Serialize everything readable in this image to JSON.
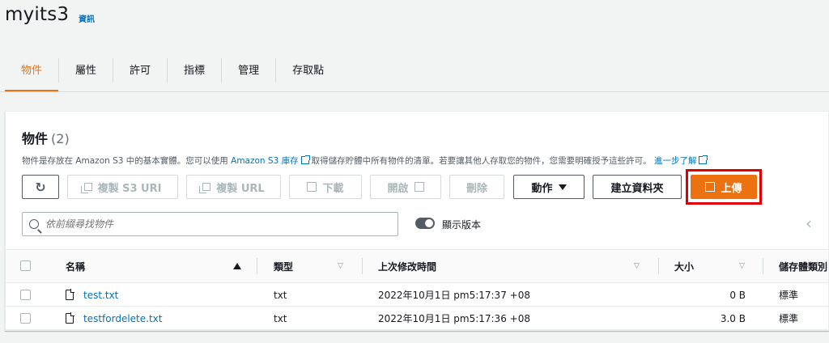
{
  "bucket": {
    "name": "myits3",
    "info_label": "資訊"
  },
  "tabs": [
    {
      "label": "物件",
      "active": true
    },
    {
      "label": "屬性"
    },
    {
      "label": "許可"
    },
    {
      "label": "指標"
    },
    {
      "label": "管理"
    },
    {
      "label": "存取點"
    }
  ],
  "objects_panel": {
    "title": "物件",
    "count": "(2)",
    "desc_prefix": "物件是存放在 Amazon S3 中的基本實體。您可以使用",
    "desc_link1": "Amazon S3 庫存",
    "desc_middle": "取得儲存貯體中所有物件的清單。若要讓其他人存取您的物件，您需要明確授予這些許可。",
    "desc_link2": "進一步了解"
  },
  "toolbar": {
    "copy_s3_uri": "複製 S3 URI",
    "copy_url": "複製 URL",
    "download": "下載",
    "open": "開啟",
    "delete": "刪除",
    "actions": "動作",
    "create_folder": "建立資料夾",
    "upload": "上傳"
  },
  "search": {
    "placeholder": "依前綴尋找物件"
  },
  "versions_toggle": {
    "label": "顯示版本"
  },
  "table": {
    "headers": {
      "name": "名稱",
      "type": "類型",
      "last_modified": "上次修改時間",
      "size": "大小",
      "storage_class": "儲存體類別"
    },
    "rows": [
      {
        "name": "test.txt",
        "type": "txt",
        "last_modified": "2022年10月1日 pm5:17:37 +08",
        "size": "0 B",
        "storage_class": "標準"
      },
      {
        "name": "testfordelete.txt",
        "type": "txt",
        "last_modified": "2022年10月1日 pm5:17:36 +08",
        "size": "3.0 B",
        "storage_class": "標準"
      }
    ]
  },
  "colors": {
    "accent": "#ec7211",
    "link": "#0073bb",
    "highlight": "#e00000"
  }
}
